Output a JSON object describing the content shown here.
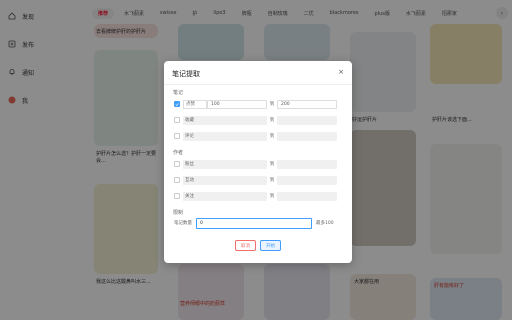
{
  "sidebar": {
    "items": [
      {
        "label": "发现",
        "icon": "home-icon"
      },
      {
        "label": "发布",
        "icon": "plus-square-icon"
      },
      {
        "label": "通知",
        "icon": "bell-icon"
      },
      {
        "label": "我",
        "icon": "avatar-icon"
      }
    ]
  },
  "tags": [
    "推荐",
    "水飞蓟素",
    "swisse",
    "护",
    "lipo3",
    "牌瓶",
    "自制玫瑰",
    "二优",
    "blackmores",
    "plus版",
    "水飞蓟素",
    "招那家",
    "护"
  ],
  "feed": {
    "captions": [
      "去看牌牌护肝的护肝片",
      "护肝片怎么选？护肝一定要会...",
      "我这么比这酸鼻叫水三...",
      "好运护肝片",
      "护肝片该选下面...",
      "大家都在用",
      "想到护肝片水飞蓟素",
      "营养师眼中的奶蓟草",
      "肝有能练好了"
    ]
  },
  "modal": {
    "title": "笔记提取",
    "close": "×",
    "section_note": "笔记",
    "section_author": "作者",
    "section_limit": "限制",
    "to": "到",
    "note_rows": [
      {
        "label": "点赞",
        "from": "100",
        "to": "200",
        "checked": true
      },
      {
        "label": "收藏",
        "from": "",
        "to": "",
        "checked": false
      },
      {
        "label": "评论",
        "from": "",
        "to": "",
        "checked": false
      }
    ],
    "author_rows": [
      {
        "label": "粉丝",
        "from": "",
        "to": "",
        "checked": false
      },
      {
        "label": "互动",
        "from": "",
        "to": "",
        "checked": false
      },
      {
        "label": "关注",
        "from": "",
        "to": "",
        "checked": false
      }
    ],
    "limit_label": "笔记数量",
    "limit_value": "0",
    "limit_note": "最多100",
    "cancel": "取消",
    "start": "开始"
  },
  "colors": {
    "accent": "#409eff",
    "danger": "#f56c6c",
    "brand": "#ff2442"
  }
}
